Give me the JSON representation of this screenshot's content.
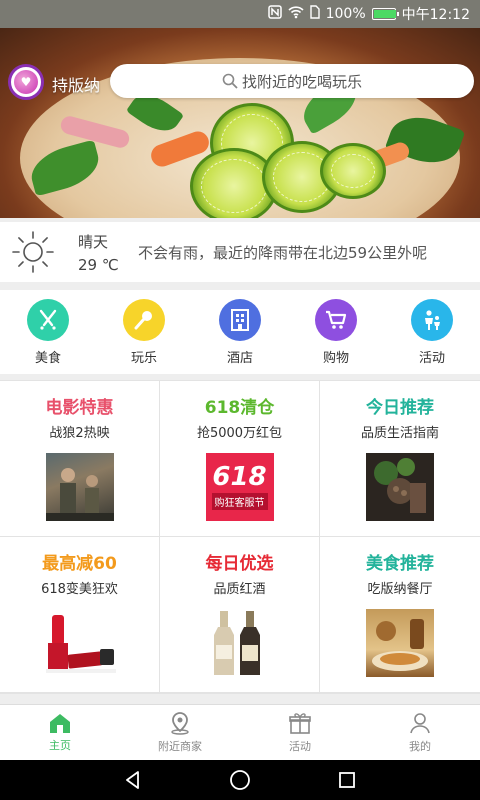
{
  "status_bar": {
    "battery": "100%",
    "time": "中午12:12",
    "nfc_icon": "nfc-icon",
    "wifi_icon": "wifi-icon",
    "sim_icon": "sim-icon",
    "battery_level": 1.0
  },
  "header": {
    "brand": "持版纳",
    "search_placeholder": "找附近的吃喝玩乐"
  },
  "banner": {
    "image": "salad-with-lime-slices",
    "slides": 5,
    "active_slide": 3
  },
  "weather": {
    "condition": "晴天",
    "temperature": "29 ℃",
    "message": "不会有雨，最近的降雨带在北边59公里外呢",
    "icon": "sun-icon"
  },
  "categories": [
    {
      "label": "美食",
      "icon": "food-icon",
      "color": "#2fd0a9"
    },
    {
      "label": "玩乐",
      "icon": "microphone-icon",
      "color": "#f7d42a"
    },
    {
      "label": "酒店",
      "icon": "hotel-icon",
      "color": "#4f6fe0"
    },
    {
      "label": "购物",
      "icon": "cart-icon",
      "color": "#8e4fe0"
    },
    {
      "label": "活动",
      "icon": "people-icon",
      "color": "#29b6ea"
    }
  ],
  "promos": [
    {
      "title": "电影特惠",
      "subtitle": "战狼2热映",
      "color": "#e8516b",
      "image": "movie-poster"
    },
    {
      "title": "618清仓",
      "subtitle": "抢5000万红包",
      "color": "#5cb82e",
      "image": "sale-banner"
    },
    {
      "title": "今日推荐",
      "subtitle": "品质生活指南",
      "color": "#23b39b",
      "image": "plants-photo"
    },
    {
      "title": "最高减60",
      "subtitle": "618变美狂欢",
      "color": "#f39a1c",
      "image": "lipstick"
    },
    {
      "title": "每日优选",
      "subtitle": "品质红酒",
      "color": "#e62b36",
      "image": "wine-bottles"
    },
    {
      "title": "美食推荐",
      "subtitle": "吃版纳餐厅",
      "color": "#23b39b",
      "image": "restaurant-food"
    }
  ],
  "sale_banner_text": {
    "big": "618",
    "small": "购狂客服节"
  },
  "tabs": [
    {
      "label": "主页",
      "icon": "home-icon",
      "active": true
    },
    {
      "label": "附近商家",
      "icon": "location-icon",
      "active": false
    },
    {
      "label": "活动",
      "icon": "gift-icon",
      "active": false
    },
    {
      "label": "我的",
      "icon": "user-icon",
      "active": false
    }
  ],
  "colors": {
    "accent": "#3dbb62"
  }
}
